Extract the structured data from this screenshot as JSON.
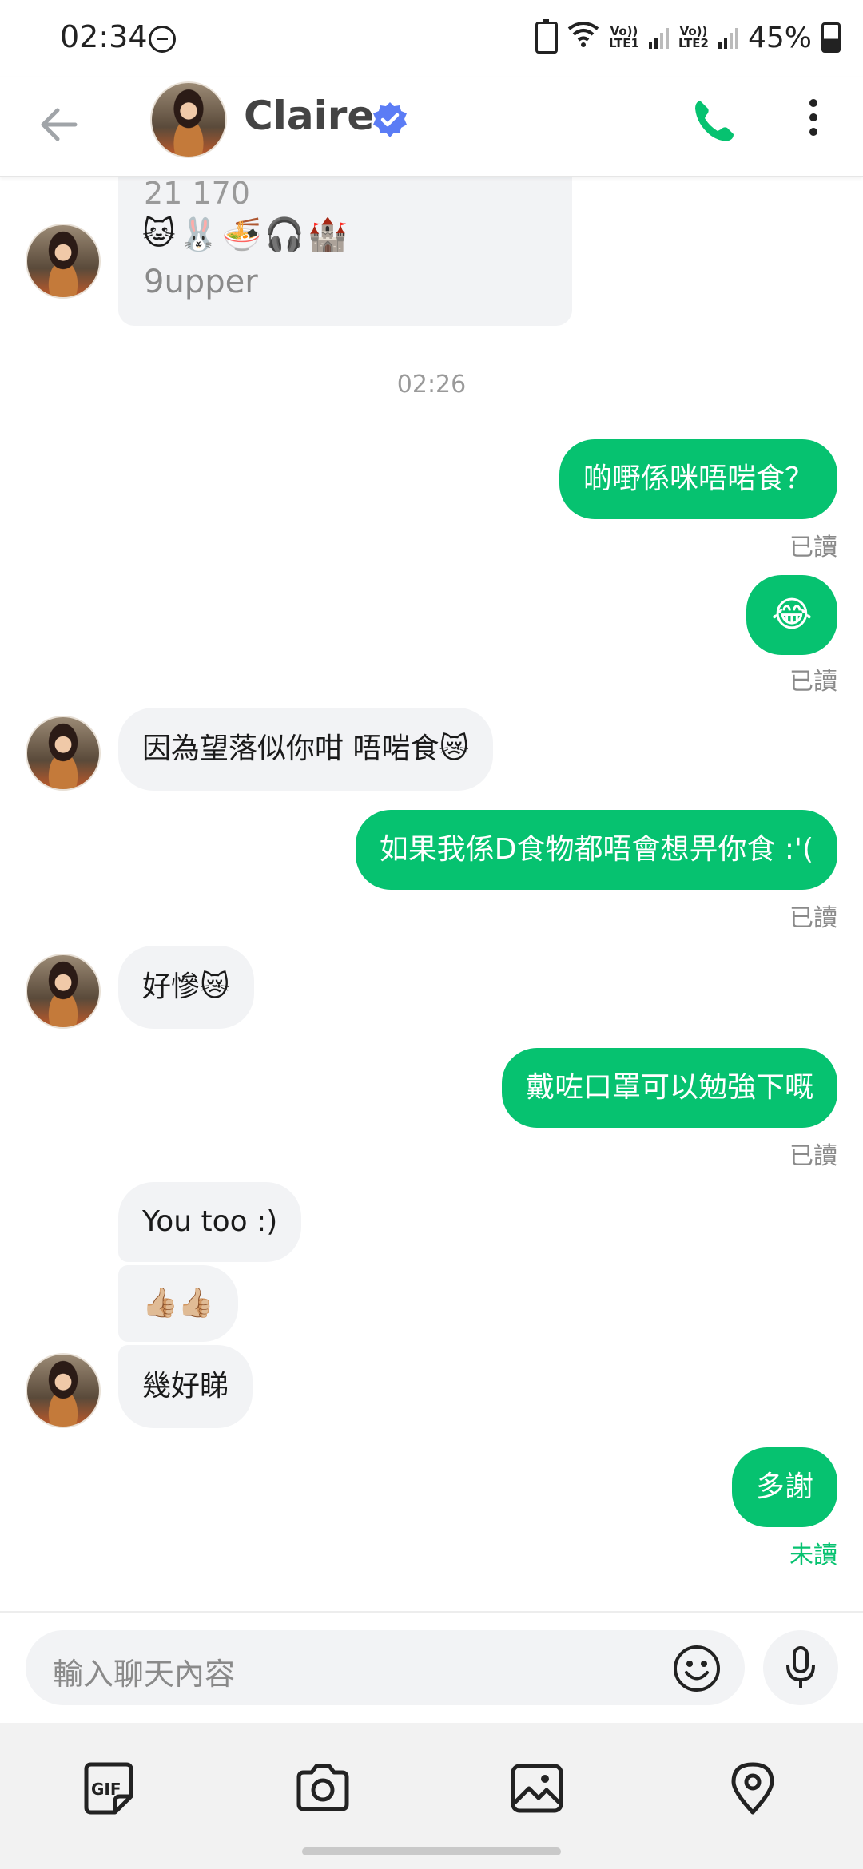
{
  "status_bar": {
    "time": "02:34",
    "lte1": "LTE1",
    "lte2": "LTE2",
    "vol_label": "Vo))",
    "battery": "45%"
  },
  "header": {
    "back_icon": "arrow-left-icon",
    "title": "Claire",
    "verified_icon": "verified-badge-icon",
    "call_icon": "phone-icon",
    "more_icon": "more-vertical-icon",
    "accent_color": "#06c270",
    "verified_color": "#5b7cf5"
  },
  "profile_card": {
    "line1": "21 170",
    "emojis": [
      "🐱",
      "🐰",
      "🍜",
      "🎧",
      "🏰"
    ],
    "line3": "9upper"
  },
  "chat": {
    "timestamp": "02:26",
    "messages": [
      {
        "side": "out",
        "text": "啲嘢係咪唔啱食？",
        "receipt": "已讀"
      },
      {
        "side": "out",
        "text": "😂",
        "receipt": "已讀"
      },
      {
        "side": "in",
        "text": "因為望落似你咁 唔啱食😿"
      },
      {
        "side": "out",
        "text": "如果我係D食物都唔會想畀你食 :'(",
        "receipt": "已讀"
      },
      {
        "side": "in",
        "text": "好慘😿"
      },
      {
        "side": "out",
        "text": "戴咗口罩可以勉強下嘅",
        "receipt": "已讀"
      },
      {
        "side": "in",
        "text": "You too :)"
      },
      {
        "side": "in",
        "text": "👍🏼👍🏼"
      },
      {
        "side": "in",
        "text": "幾好睇"
      },
      {
        "side": "out",
        "text": "多謝",
        "receipt": "未讀"
      }
    ]
  },
  "input_bar": {
    "placeholder": "輸入聊天內容",
    "emoji_icon": "smiley-icon",
    "mic_icon": "microphone-icon"
  },
  "toolbar": {
    "items": [
      "gif-icon",
      "camera-icon",
      "image-icon",
      "location-pin-icon"
    ]
  }
}
